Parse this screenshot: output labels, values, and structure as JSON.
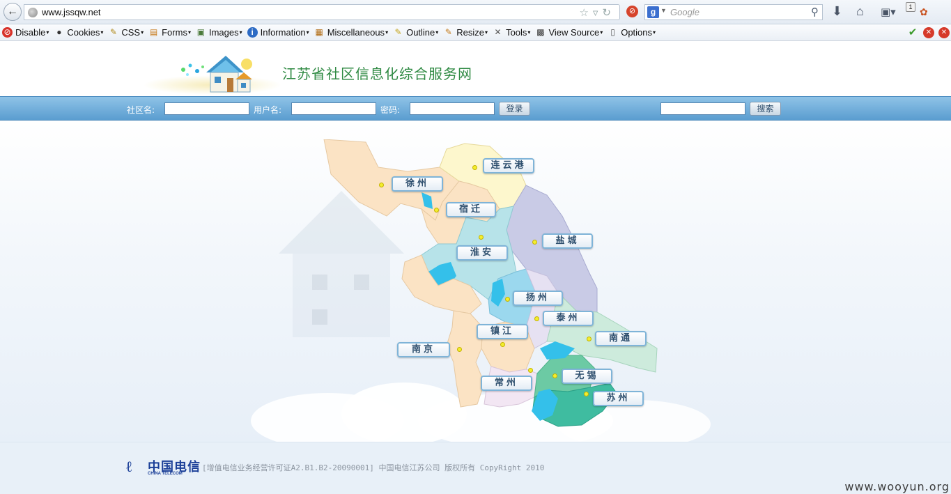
{
  "browser": {
    "url": "www.jssqw.net",
    "search_placeholder": "Google",
    "search_engine_letter": "g",
    "tab_badge": "1"
  },
  "devtools": {
    "items": [
      {
        "label": "Disable",
        "icon": "disable-icon"
      },
      {
        "label": "Cookies",
        "icon": "cookies-icon"
      },
      {
        "label": "CSS",
        "icon": "css-icon"
      },
      {
        "label": "Forms",
        "icon": "forms-icon"
      },
      {
        "label": "Images",
        "icon": "images-icon"
      },
      {
        "label": "Information",
        "icon": "information-icon"
      },
      {
        "label": "Miscellaneous",
        "icon": "miscellaneous-icon"
      },
      {
        "label": "Outline",
        "icon": "outline-icon"
      },
      {
        "label": "Resize",
        "icon": "resize-icon"
      },
      {
        "label": "Tools",
        "icon": "tools-icon"
      },
      {
        "label": "View Source",
        "icon": "view-source-icon"
      },
      {
        "label": "Options",
        "icon": "options-icon"
      }
    ]
  },
  "header": {
    "title": "江苏省社区信息化综合服务网"
  },
  "login": {
    "community_label": "社区名:",
    "username_label": "用户名:",
    "password_label": "密码:",
    "login_button": "登录",
    "search_button": "搜索"
  },
  "map": {
    "cities": [
      {
        "name": "连云港"
      },
      {
        "name": "徐州"
      },
      {
        "name": "宿迁"
      },
      {
        "name": "盐城"
      },
      {
        "name": "淮安"
      },
      {
        "name": "扬州"
      },
      {
        "name": "泰州"
      },
      {
        "name": "南通"
      },
      {
        "name": "镇江"
      },
      {
        "name": "南京"
      },
      {
        "name": "无锡"
      },
      {
        "name": "常州"
      },
      {
        "name": "苏州"
      }
    ]
  },
  "footer": {
    "logo_cn": "中国电信",
    "logo_en": "CHINA TELECOM",
    "license": "[增值电信业务经营许可证A2.B1.B2-20090001]  中国电信江苏公司 版权所有 CopyRight 2010"
  },
  "watermark": "www.wooyun.org"
}
